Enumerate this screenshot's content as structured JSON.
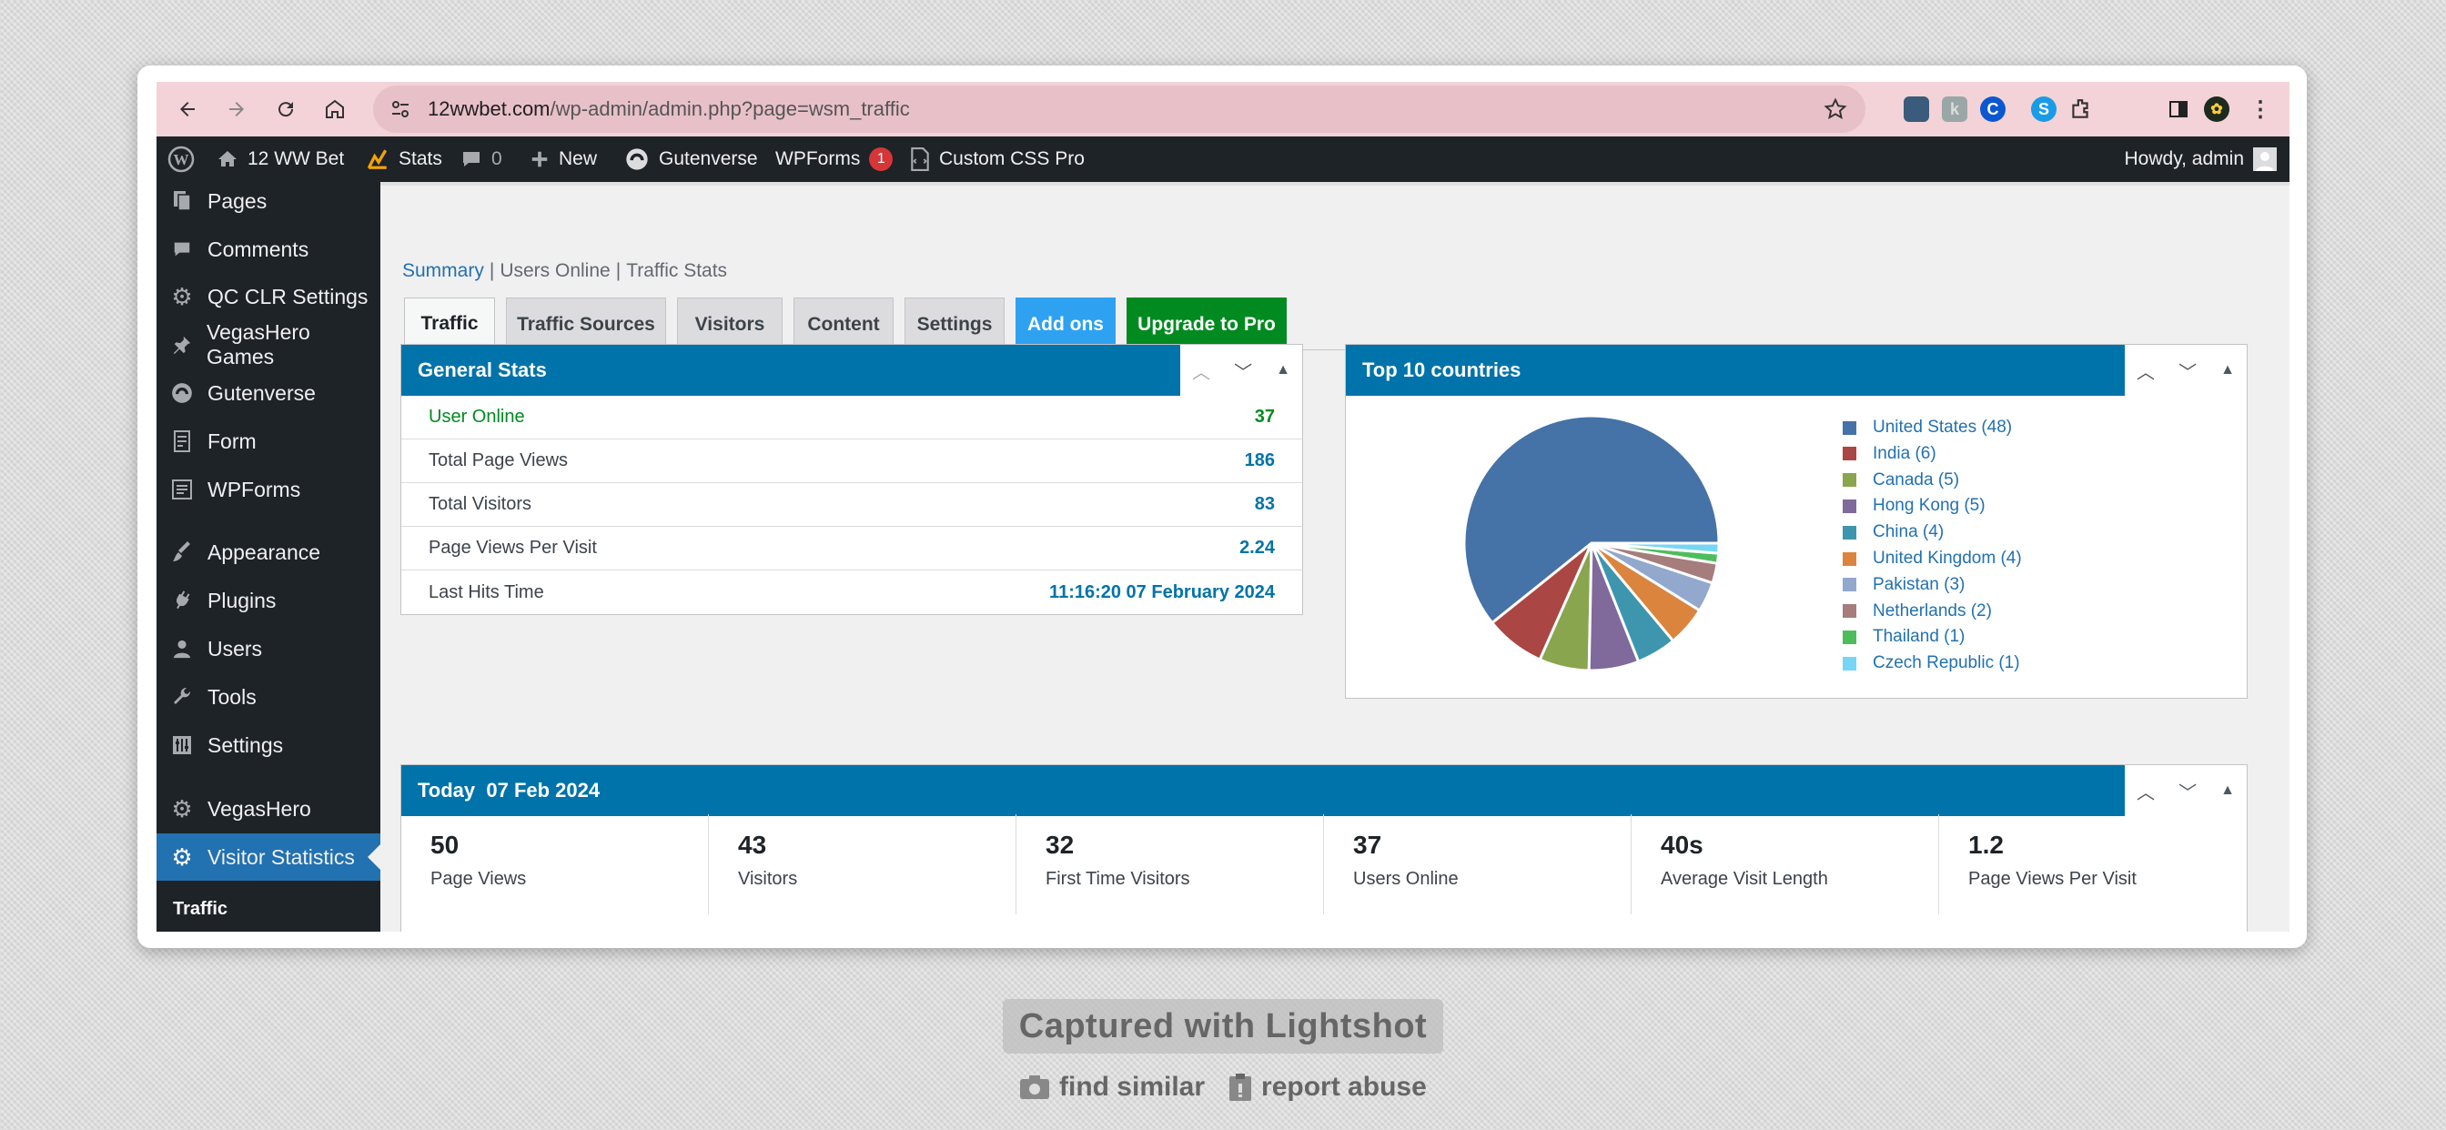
{
  "browser": {
    "url_host": "12wwbet.com",
    "url_path": "/wp-admin/admin.php?page=wsm_traffic"
  },
  "adminbar": {
    "site_name": "12 WW Bet",
    "stats": "Stats",
    "comments_count": "0",
    "new_label": "New",
    "gutenverse": "Gutenverse",
    "wpforms": "WPForms",
    "wpforms_badge": "1",
    "custom_css": "Custom CSS Pro",
    "howdy": "Howdy, admin"
  },
  "sidebar": {
    "items": [
      {
        "label": "Pages",
        "icon": "pages-icon"
      },
      {
        "label": "Comments",
        "icon": "comments-icon"
      },
      {
        "label": "QC CLR Settings",
        "icon": "gear-icon"
      },
      {
        "label": "VegasHero Games",
        "icon": "pin-icon"
      },
      {
        "label": "Gutenverse",
        "icon": "gutenverse-icon"
      },
      {
        "label": "Form",
        "icon": "form-icon"
      },
      {
        "label": "WPForms",
        "icon": "wpforms-icon"
      },
      {
        "label": "Appearance",
        "icon": "brush-icon"
      },
      {
        "label": "Plugins",
        "icon": "plug-icon"
      },
      {
        "label": "Users",
        "icon": "user-icon"
      },
      {
        "label": "Tools",
        "icon": "wrench-icon"
      },
      {
        "label": "Settings",
        "icon": "settings-icon"
      },
      {
        "label": "VegasHero",
        "icon": "gear-icon"
      },
      {
        "label": "Visitor Statistics",
        "icon": "gear-icon"
      }
    ],
    "submenu_current": "Traffic"
  },
  "tabs": [
    "Traffic",
    "Traffic Sources",
    "Visitors",
    "Content",
    "Settings",
    "Add ons",
    "Upgrade to Pro"
  ],
  "subnav": [
    "Summary",
    "Users Online",
    "Traffic Stats"
  ],
  "general_stats": {
    "title": "General Stats",
    "rows": [
      {
        "label": "User Online",
        "value": "37"
      },
      {
        "label": "Total Page Views",
        "value": "186"
      },
      {
        "label": "Total Visitors",
        "value": "83"
      },
      {
        "label": "Page Views Per Visit",
        "value": "2.24"
      },
      {
        "label": "Last Hits Time",
        "value": "11:16:20 07 February 2024"
      }
    ]
  },
  "top_countries": {
    "title": "Top 10 countries",
    "legend": [
      "United States (48)",
      "India (6)",
      "Canada (5)",
      "Hong Kong (5)",
      "China (4)",
      "United Kingdom (4)",
      "Pakistan (3)",
      "Netherlands (2)",
      "Thailand (1)",
      "Czech Republic (1)"
    ]
  },
  "chart_data": {
    "type": "pie",
    "categories": [
      "United States",
      "India",
      "Canada",
      "Hong Kong",
      "China",
      "United Kingdom",
      "Pakistan",
      "Netherlands",
      "Thailand",
      "Czech Republic"
    ],
    "values": [
      48,
      6,
      5,
      5,
      4,
      4,
      3,
      2,
      1,
      1
    ],
    "colors": [
      "#4572a7",
      "#aa4643",
      "#89a54e",
      "#80699b",
      "#3d96ae",
      "#db843d",
      "#92a8cd",
      "#a47d7c",
      "#4dbd5b",
      "#76d6f5"
    ],
    "title": "Top 10 countries",
    "legend_position": "right"
  },
  "today": {
    "title": "Today  07 Feb 2024",
    "cells": [
      {
        "value": "50",
        "label": "Page Views"
      },
      {
        "value": "43",
        "label": "Visitors"
      },
      {
        "value": "32",
        "label": "First Time Visitors"
      },
      {
        "value": "37",
        "label": "Users Online"
      },
      {
        "value": "40s",
        "label": "Average Visit Length"
      },
      {
        "value": "1.2",
        "label": "Page Views Per Visit"
      }
    ]
  },
  "lightshot": {
    "captured": "Captured with Lightshot",
    "find_similar": "find similar",
    "report_abuse": "report abuse"
  }
}
